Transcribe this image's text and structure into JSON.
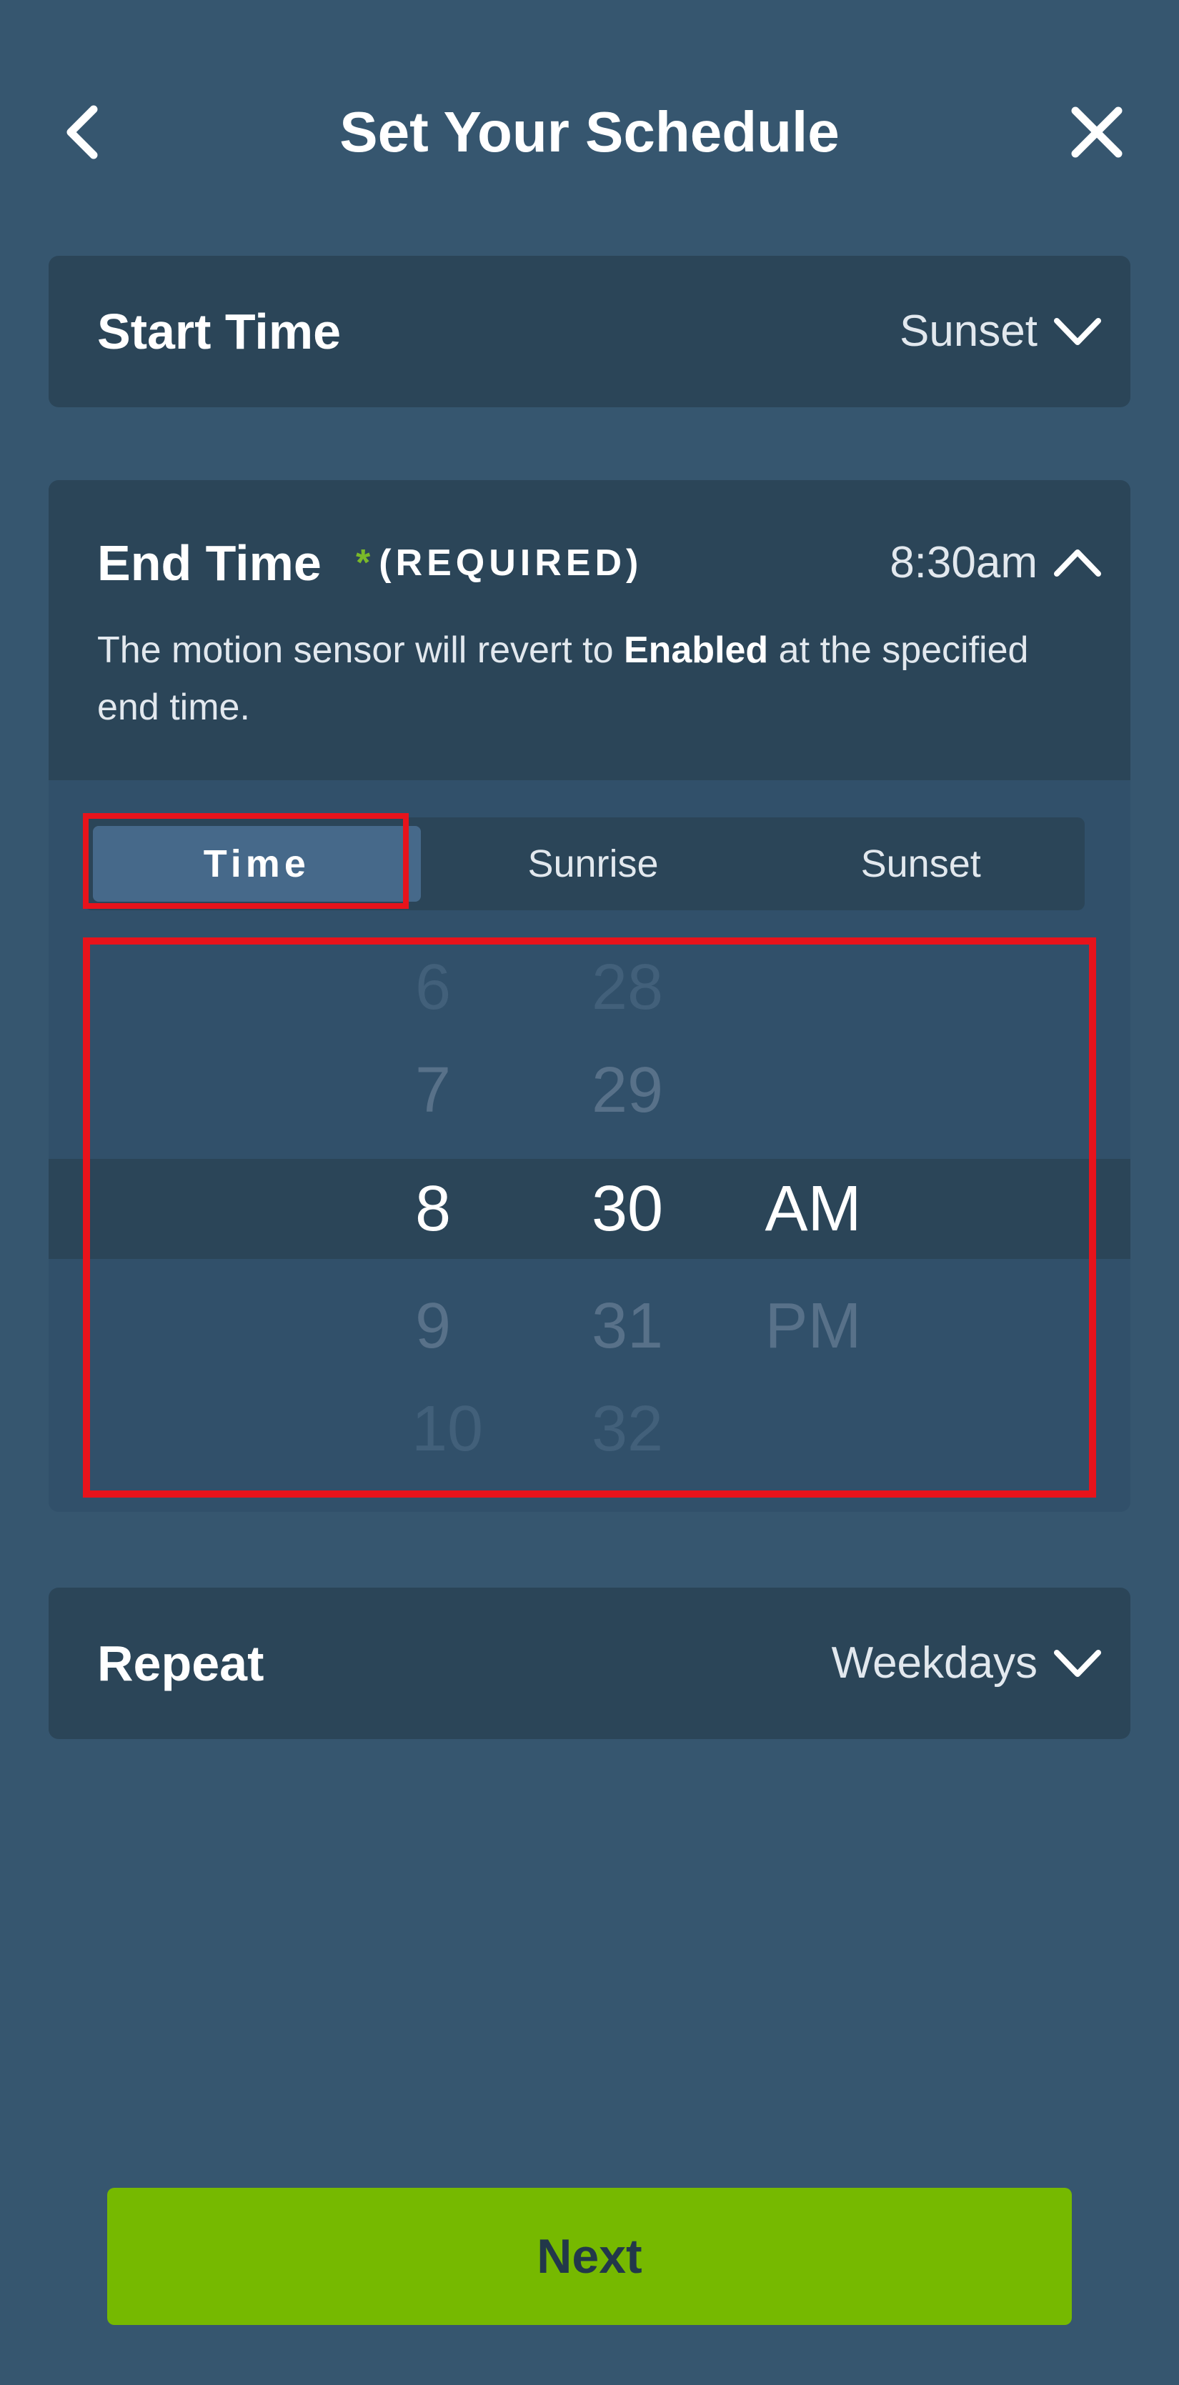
{
  "header": {
    "title": "Set Your Schedule",
    "back_icon": "chevron-left-icon",
    "close_icon": "close-icon"
  },
  "start_time": {
    "label": "Start Time",
    "value": "Sunset",
    "icon": "chevron-down-icon"
  },
  "end_time": {
    "label": "End Time",
    "required_star": "*",
    "required_label": "(REQUIRED)",
    "value": "8:30am",
    "icon": "chevron-up-icon",
    "desc_before": "The motion sensor will revert to ",
    "desc_bold": "Enabled",
    "desc_after": " at the specified end time.",
    "segments": [
      "Time",
      "Sunrise",
      "Sunset"
    ],
    "selected_segment": "Time",
    "picker": {
      "hours": [
        "6",
        "7",
        "8",
        "9",
        "10"
      ],
      "minutes": [
        "28",
        "29",
        "30",
        "31",
        "32"
      ],
      "periods": [
        "AM",
        "PM"
      ],
      "selected": {
        "hour": "8",
        "minute": "30",
        "period": "AM"
      }
    }
  },
  "repeat": {
    "label": "Repeat",
    "value": "Weekdays",
    "icon": "chevron-down-icon"
  },
  "footer": {
    "next_label": "Next"
  },
  "colors": {
    "background": "#36566f",
    "card": "#2b4558",
    "accent_green": "#76b900",
    "highlight_red": "#e8131b"
  }
}
